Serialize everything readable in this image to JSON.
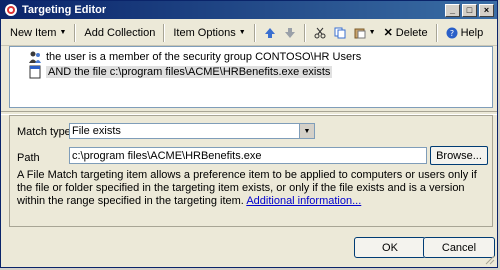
{
  "window": {
    "title": "Targeting Editor"
  },
  "toolbar": {
    "new_item": "New Item",
    "add_collection": "Add Collection",
    "item_options": "Item Options",
    "delete": "Delete",
    "help": "Help"
  },
  "tree": {
    "items": [
      {
        "label": "the user is a member of the security group CONTOSO\\HR Users",
        "icon": "users-icon"
      },
      {
        "label": "AND the file c:\\program files\\ACME\\HRBenefits.exe exists",
        "icon": "file-icon",
        "selected": true
      }
    ]
  },
  "panel": {
    "match_type_label": "Match type",
    "match_type_value": "File exists",
    "path_label": "Path",
    "path_value": "c:\\program files\\ACME\\HRBenefits.exe",
    "browse_label": "Browse...",
    "description": "A File Match targeting item allows a preference item to be applied to computers or users only if the file or folder specified in the targeting item exists, or only if the file exists and is a version within the range specified in the targeting item.",
    "more_link": "Additional information..."
  },
  "buttons": {
    "ok": "OK",
    "cancel": "Cancel"
  }
}
